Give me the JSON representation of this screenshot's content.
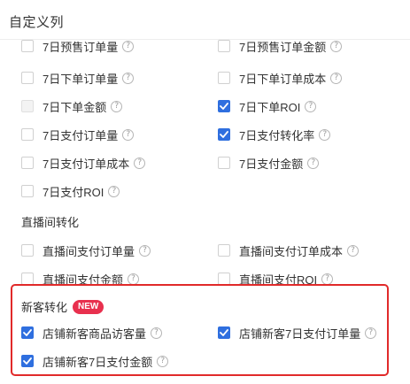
{
  "panel": {
    "title": "自定义列"
  },
  "help_glyph": "?",
  "options": {
    "presale_orders": {
      "label": "7日预售订单量",
      "checked": false
    },
    "presale_amount": {
      "label": "7日预售订单金额",
      "checked": false
    },
    "orders_placed": {
      "label": "7日下单订单量",
      "checked": false
    },
    "order_cost": {
      "label": "7日下单订单成本",
      "checked": false
    },
    "order_amount": {
      "label": "7日下单金额",
      "checked": false,
      "disabled": true
    },
    "order_roi": {
      "label": "7日下单ROI",
      "checked": true
    },
    "paid_orders": {
      "label": "7日支付订单量",
      "checked": false
    },
    "pay_conversion": {
      "label": "7日支付转化率",
      "checked": true
    },
    "paid_order_cost": {
      "label": "7日支付订单成本",
      "checked": false
    },
    "paid_amount": {
      "label": "7日支付金额",
      "checked": false
    },
    "paid_roi": {
      "label": "7日支付ROI",
      "checked": false
    }
  },
  "live_section": {
    "title": "直播间转化",
    "live_paid_orders": {
      "label": "直播间支付订单量",
      "checked": false
    },
    "live_paid_cost": {
      "label": "直播间支付订单成本",
      "checked": false
    },
    "live_paid_amount": {
      "label": "直播间支付金额",
      "checked": false
    },
    "live_paid_roi": {
      "label": "直播间支付ROI",
      "checked": false
    }
  },
  "new_customer_section": {
    "title": "新客转化",
    "badge": "NEW",
    "new_visitors": {
      "label": "店铺新客商品访客量",
      "checked": true
    },
    "new_paid_orders": {
      "label": "店铺新客7日支付订单量",
      "checked": true
    },
    "new_paid_amount": {
      "label": "店铺新客7日支付金额",
      "checked": true
    }
  },
  "colors": {
    "checkbox_checked": "#2f6fdf",
    "highlight_border": "#e12a2a",
    "badge": "#e8304e"
  }
}
